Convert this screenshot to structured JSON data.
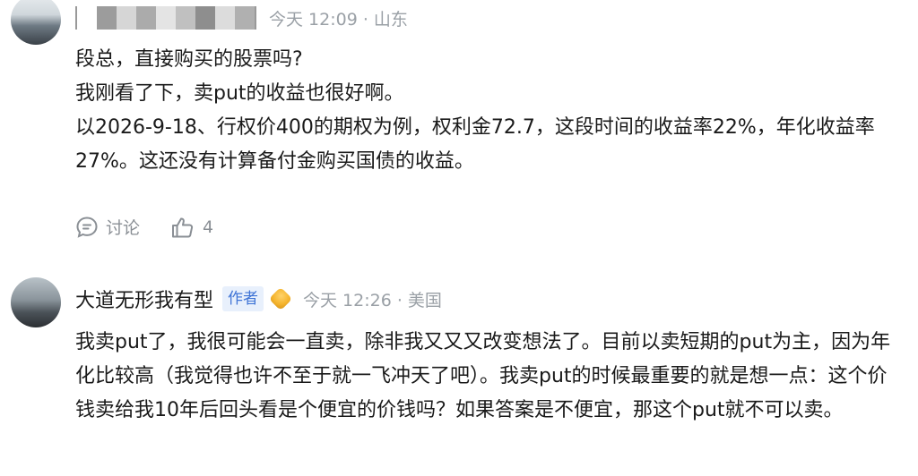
{
  "comments": [
    {
      "meta": "今天 12:09 · 山东",
      "paragraphs": [
        "段总，直接购买的股票吗?",
        "我刚看了下，卖put的收益也很好啊。",
        "以2026-9-18、行权价400的期权为例，权利金72.7，这段时间的收益率22%，年化收益率27%。这还没有计算备付金购买国债的收益。"
      ],
      "actions": {
        "discuss_label": "讨论",
        "like_count": "4"
      }
    },
    {
      "username": "大道无形我有型",
      "badge": "作者",
      "meta": "今天 12:26 · 美国",
      "paragraphs": [
        "我卖put了，我很可能会一直卖，除非我又又又改变想法了。目前以卖短期的put为主，因为年化比较高（我觉得也许不至于就一飞冲天了吧）。我卖put的时候最重要的就是想一点：这个价钱卖给我10年后回头看是个便宜的价钱吗？如果答案是不便宜，那这个put就不可以卖。"
      ]
    }
  ],
  "colors": {
    "meta": "#9aa0a6",
    "author_badge_bg": "#e8f0fc",
    "author_badge_text": "#3f74d6",
    "action": "#8a8f95"
  },
  "icons": {
    "discuss": "chat-bubble-icon",
    "like": "thumbs-up-icon",
    "level": "gold-level-badge-icon"
  }
}
